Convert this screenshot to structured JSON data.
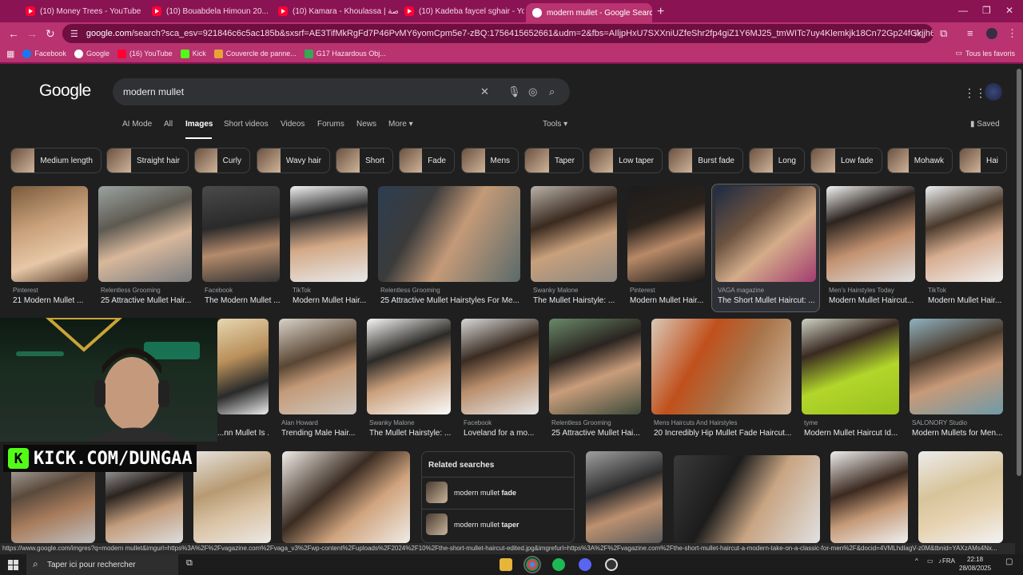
{
  "browser": {
    "tabs": [
      {
        "label": "(10) Money Trees - YouTube",
        "active": false
      },
      {
        "label": "(10) Bouabdela Himoun 20...",
        "active": false
      },
      {
        "label": "(10) Kamara - Khoulassa | الخلاصة...",
        "active": false
      },
      {
        "label": "(10) Kadeba faycel sghair - You...",
        "active": false
      },
      {
        "label": "modern mullet - Google Search",
        "active": true
      }
    ],
    "new_tab": "+",
    "url_domain": "google.com",
    "url_path": "/search?sca_esv=921846c6c5ac185b&sxsrf=AE3TifMkRgFd7P46PvMY6yomCpm5e7-zBQ:1756415652661&udm=2&fbs=AIljpHxU7SXXniUZfeShr2fp4giZ1Y6MJ25_tmWITc7uy4Klemkjk18Cn72Gp24fGkjjh6wQFCVbKXb4P6swJy4x5wjmp_jXu...",
    "bookmarks": [
      {
        "label": "Facebook",
        "color": "#1877f2"
      },
      {
        "label": "Google",
        "color": "#ffffff"
      },
      {
        "label": "(16) YouTube",
        "color": "#ff0033"
      },
      {
        "label": "Kick",
        "color": "#53fc18"
      },
      {
        "label": "Couvercle de panne...",
        "color": "#e8a23a"
      },
      {
        "label": "G17 Hazardous Obj...",
        "color": "#34a853"
      }
    ],
    "all_bookmarks": "Tous les favoris"
  },
  "google": {
    "logo": "Google",
    "query": "modern mullet",
    "nav": [
      "AI Mode",
      "All",
      "Images",
      "Short videos",
      "Videos",
      "Forums",
      "News",
      "More"
    ],
    "active_nav": "Images",
    "tools": "Tools",
    "saved": "Saved",
    "chips": [
      "Medium length",
      "Straight hair",
      "Curly",
      "Wavy hair",
      "Short",
      "Fade",
      "Mens",
      "Taper",
      "Low taper",
      "Burst fade",
      "Long",
      "Low fade",
      "Mohawk",
      "Hai"
    ],
    "row1": [
      {
        "source": "Pinterest",
        "title": "21 Modern Mullet ..."
      },
      {
        "source": "Relentless Grooming",
        "title": "25 Attractive Mullet Hair..."
      },
      {
        "source": "Facebook",
        "title": "The Modern Mullet ..."
      },
      {
        "source": "TikTok",
        "title": "Modern Mullet Hair..."
      },
      {
        "source": "Relentless Grooming",
        "title": "25 Attractive Mullet Hairstyles For Me..."
      },
      {
        "source": "Swanky Malone",
        "title": "The Mullet Hairstyle: ..."
      },
      {
        "source": "Pinterest",
        "title": "Modern Mullet Hair..."
      },
      {
        "source": "VAGA magazine",
        "title": "The Short Mullet Haircut: ..."
      },
      {
        "source": "Men's Hairstyles Today",
        "title": "Modern Mullet Haircut..."
      },
      {
        "source": "TikTok",
        "title": "Modern Mullet Hair..."
      }
    ],
    "row2": [
      {
        "source": "",
        "title": "...nn Mullet Is ..."
      },
      {
        "source": "Alan Howard",
        "title": "Trending Male Hair..."
      },
      {
        "source": "Swanky Malone",
        "title": "The Mullet Hairstyle: ..."
      },
      {
        "source": "Facebook",
        "title": "Loveland for a mo..."
      },
      {
        "source": "Relentless Grooming",
        "title": "25 Attractive Mullet Hai..."
      },
      {
        "source": "Mens Haircuts And Hairstyles",
        "title": "20 Incredibly Hip Mullet Fade Haircut..."
      },
      {
        "source": "tyme",
        "title": "Modern Mullet Haircut Id..."
      },
      {
        "source": "SALONORY Studio",
        "title": "Modern Mullets for Men..."
      }
    ],
    "related": {
      "heading": "Related searches",
      "items": [
        {
          "prefix": "modern mullet ",
          "bold": "fade"
        },
        {
          "prefix": "modern mullet ",
          "bold": "taper"
        }
      ]
    }
  },
  "overlay": {
    "kick_text": "KICK.COM/DUNGAA",
    "kick_letter": "K"
  },
  "status_url": "https://www.google.com/imgres?q=modern mullet&imgurl=https%3A%2F%2Fvagazine.com%2Fvaga_v3%2Fwp-content%2Fuploads%2F2024%2F10%2Fthe-short-mullet-haircut-edited.jpg&imgrefurl=https%3A%2F%2Fvagazine.com%2Fthe-short-mullet-haircut-a-modern-take-on-a-classic-for-men%2F&docid=4VMLhdlagV-z0M&tbnid=YAXzAMs4Nx...",
  "taskbar": {
    "search_placeholder": "Taper ici pour rechercher",
    "lang": "FRA",
    "time": "22:18",
    "date": "28/08/2025"
  }
}
